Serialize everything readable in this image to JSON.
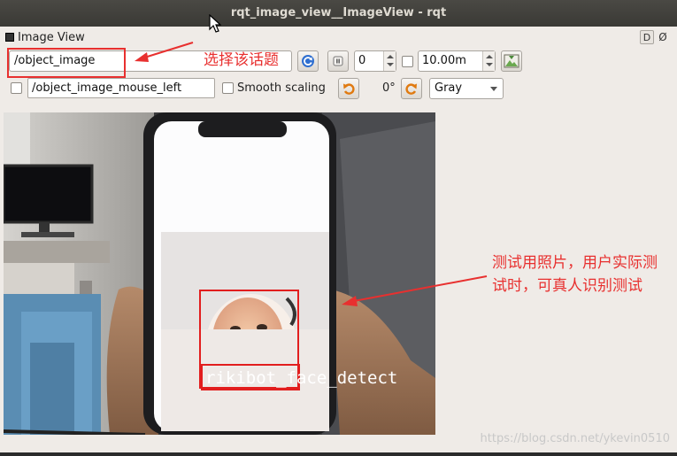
{
  "window": {
    "title": "rqt_image_view__ImageView - rqt"
  },
  "panel": {
    "title": "Image View",
    "help_btn": "D",
    "close_btn": "Ø"
  },
  "toolbar": {
    "topic_selected": "/object_image",
    "frame_skip_value": "0",
    "delay_value": "10.00m",
    "mouse_topic_value": "/object_image_mouse_left",
    "smooth_scaling_label": "Smooth scaling",
    "rotation_label": "0°",
    "color_scheme_selected": "Gray"
  },
  "annotations": {
    "select_topic": "选择该话题",
    "photo_note": "测试用照片，用户实际测试时，可真人识别测试"
  },
  "image": {
    "detection_label": "rikibot_face_detect"
  },
  "watermark": "https://blog.csdn.net/ykevin0510",
  "colors": {
    "annotation_red": "#e8302f",
    "detect_red": "#e21e1e"
  }
}
